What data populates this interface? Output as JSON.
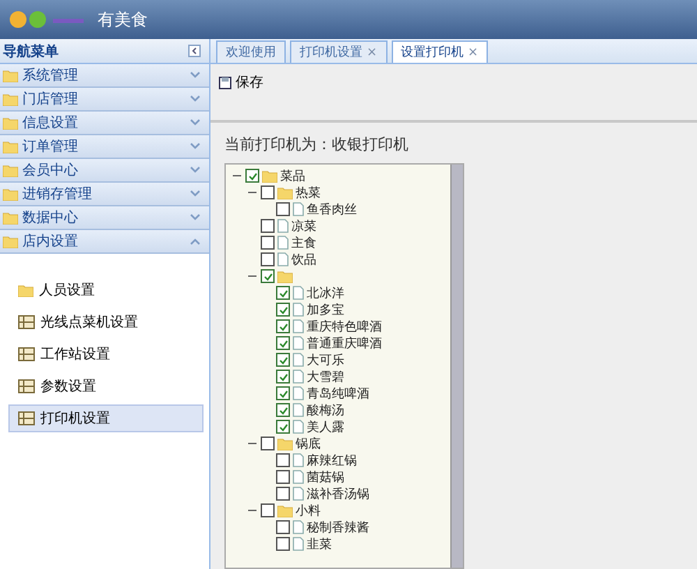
{
  "header": {
    "title": "有美食"
  },
  "sidebar": {
    "title": "导航菜单",
    "items": [
      {
        "label": "系统管理",
        "expanded": false
      },
      {
        "label": "门店管理",
        "expanded": false
      },
      {
        "label": "信息设置",
        "expanded": false
      },
      {
        "label": "订单管理",
        "expanded": false
      },
      {
        "label": "会员中心",
        "expanded": false
      },
      {
        "label": "进销存管理",
        "expanded": false
      },
      {
        "label": "数据中心",
        "expanded": false
      },
      {
        "label": "店内设置",
        "expanded": true,
        "children": [
          {
            "label": "人员设置",
            "selected": false,
            "kind": "folder"
          },
          {
            "label": "光线点菜机设置",
            "selected": false,
            "kind": "grid"
          },
          {
            "label": "工作站设置",
            "selected": false,
            "kind": "grid"
          },
          {
            "label": "参数设置",
            "selected": false,
            "kind": "grid"
          },
          {
            "label": "打印机设置",
            "selected": true,
            "kind": "grid"
          }
        ]
      }
    ]
  },
  "tabs": [
    {
      "label": "欢迎使用",
      "selected": false,
      "closable": false
    },
    {
      "label": "打印机设置",
      "selected": false,
      "closable": true
    },
    {
      "label": "设置打印机",
      "selected": true,
      "closable": true
    }
  ],
  "close_mark": "×",
  "toolbar": {
    "save": "保存"
  },
  "printer_line": "当前打印机为：收银打印机",
  "tree": [
    {
      "label": "菜品",
      "checked": true,
      "children": [
        {
          "label": "热菜",
          "checked": false,
          "children": [
            {
              "label": "鱼香肉丝",
              "checked": false
            }
          ]
        },
        {
          "label": "凉菜",
          "checked": false
        },
        {
          "label": "主食",
          "checked": false
        },
        {
          "label": "饮品",
          "checked": false
        },
        {
          "checked": true,
          "children": [
            {
              "label": "北冰洋",
              "checked": true
            },
            {
              "label": "加多宝",
              "checked": true
            },
            {
              "label": "重庆特色啤酒",
              "checked": true
            },
            {
              "label": "普通重庆啤酒",
              "checked": true
            },
            {
              "label": "大可乐",
              "checked": true
            },
            {
              "label": "大雪碧",
              "checked": true
            },
            {
              "label": "青岛纯啤酒",
              "checked": true
            },
            {
              "label": "酸梅汤",
              "checked": true
            },
            {
              "label": "美人露",
              "checked": true
            }
          ]
        },
        {
          "label": "锅底",
          "checked": false,
          "children": [
            {
              "label": "麻辣红锅",
              "checked": false
            },
            {
              "label": "菌菇锅",
              "checked": false
            },
            {
              "label": "滋补香汤锅",
              "checked": false
            }
          ]
        },
        {
          "label": "小料",
          "checked": false,
          "children": [
            {
              "label": "秘制香辣酱",
              "checked": false
            },
            {
              "label": "韭菜",
              "checked": false
            }
          ]
        }
      ]
    }
  ]
}
